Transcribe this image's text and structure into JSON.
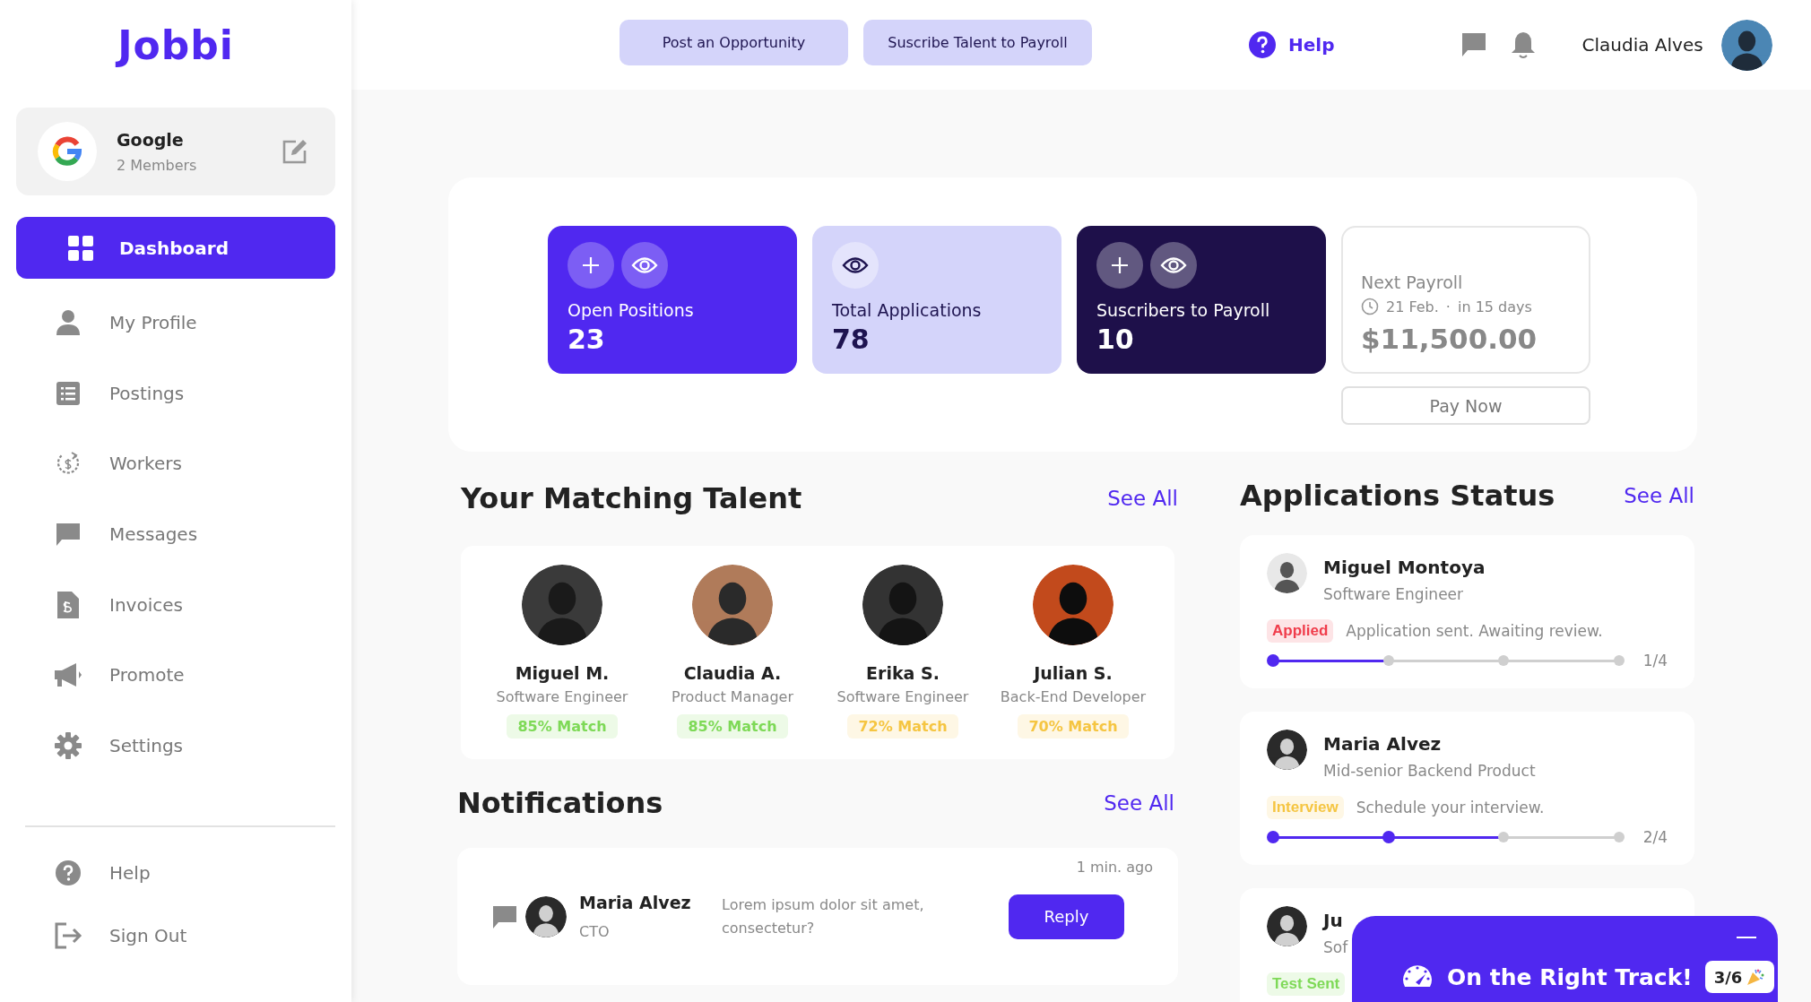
{
  "logo": "Jobbi",
  "organization": {
    "name": "Google",
    "members": "2 Members"
  },
  "sidebar": {
    "items": [
      {
        "label": "Dashboard",
        "selected": true
      },
      {
        "label": "My Profile",
        "selected": false
      },
      {
        "label": "Postings",
        "selected": false
      },
      {
        "label": "Workers",
        "selected": false
      },
      {
        "label": "Messages",
        "selected": false
      },
      {
        "label": "Invoices",
        "selected": false
      },
      {
        "label": "Promote",
        "selected": false
      },
      {
        "label": "Settings",
        "selected": false
      }
    ],
    "bottom_items": [
      "Help",
      "Sign Out"
    ]
  },
  "topbar": {
    "buttons": [
      "Post an Opportunity",
      "Suscribe Talent to Payroll"
    ],
    "help": "Help",
    "user": "Claudia Alves"
  },
  "stats": [
    {
      "kind": "primary",
      "label": "Open Positions",
      "value": "23"
    },
    {
      "kind": "light",
      "label": "Total Applications",
      "value": "78"
    },
    {
      "kind": "dark",
      "label": "Suscribers to Payroll",
      "value": "10"
    }
  ],
  "payroll": {
    "title": "Next Payroll",
    "date": "21 Feb.",
    "separator": "·",
    "due": "in 15 days",
    "amount": "$11,500.00",
    "button": "Pay Now"
  },
  "talent": {
    "title": "Your Matching Talent",
    "see_all": "See All",
    "people": [
      {
        "name": "Miguel M.",
        "role": "Software Engineer",
        "match": "85% Match",
        "color": "#7ed957"
      },
      {
        "name": "Claudia A.",
        "role": "Product Manager",
        "match": "85% Match",
        "color": "#7ed957"
      },
      {
        "name": "Erika S.",
        "role": "Software Engineer",
        "match": "72% Match",
        "color": "#f5c542"
      },
      {
        "name": "Julian S.",
        "role": "Back-End Developer",
        "match": "70% Match",
        "color": "#f5c542"
      }
    ]
  },
  "notifications": {
    "title": "Notifications",
    "see_all": "See All",
    "items": [
      {
        "time": "1 min. ago",
        "name": "Maria Alvez",
        "role": "CTO",
        "message": "Lorem ipsum dolor sit amet, consectetur?",
        "button": "Reply"
      }
    ]
  },
  "applications": {
    "title": "Applications Status",
    "see_all": "See All",
    "items": [
      {
        "name": "Miguel Montoya",
        "role": "Software Engineer",
        "status": "Applied",
        "color": "#f03c4b",
        "note": "Application sent. Awaiting review.",
        "level": 0.333,
        "step": "1/4"
      },
      {
        "name": "Maria Alvez",
        "role": "Mid-senior Backend Product",
        "status": "Interview",
        "color": "#f5c542",
        "note": "Schedule your interview.",
        "level": 0.667,
        "step": "2/4"
      },
      {
        "name": "Ju",
        "role": "Sof",
        "status": "Test Sent",
        "color": "#7ed957"
      }
    ]
  },
  "toast": {
    "title": "On the Right Track!",
    "progress": "3/6"
  }
}
